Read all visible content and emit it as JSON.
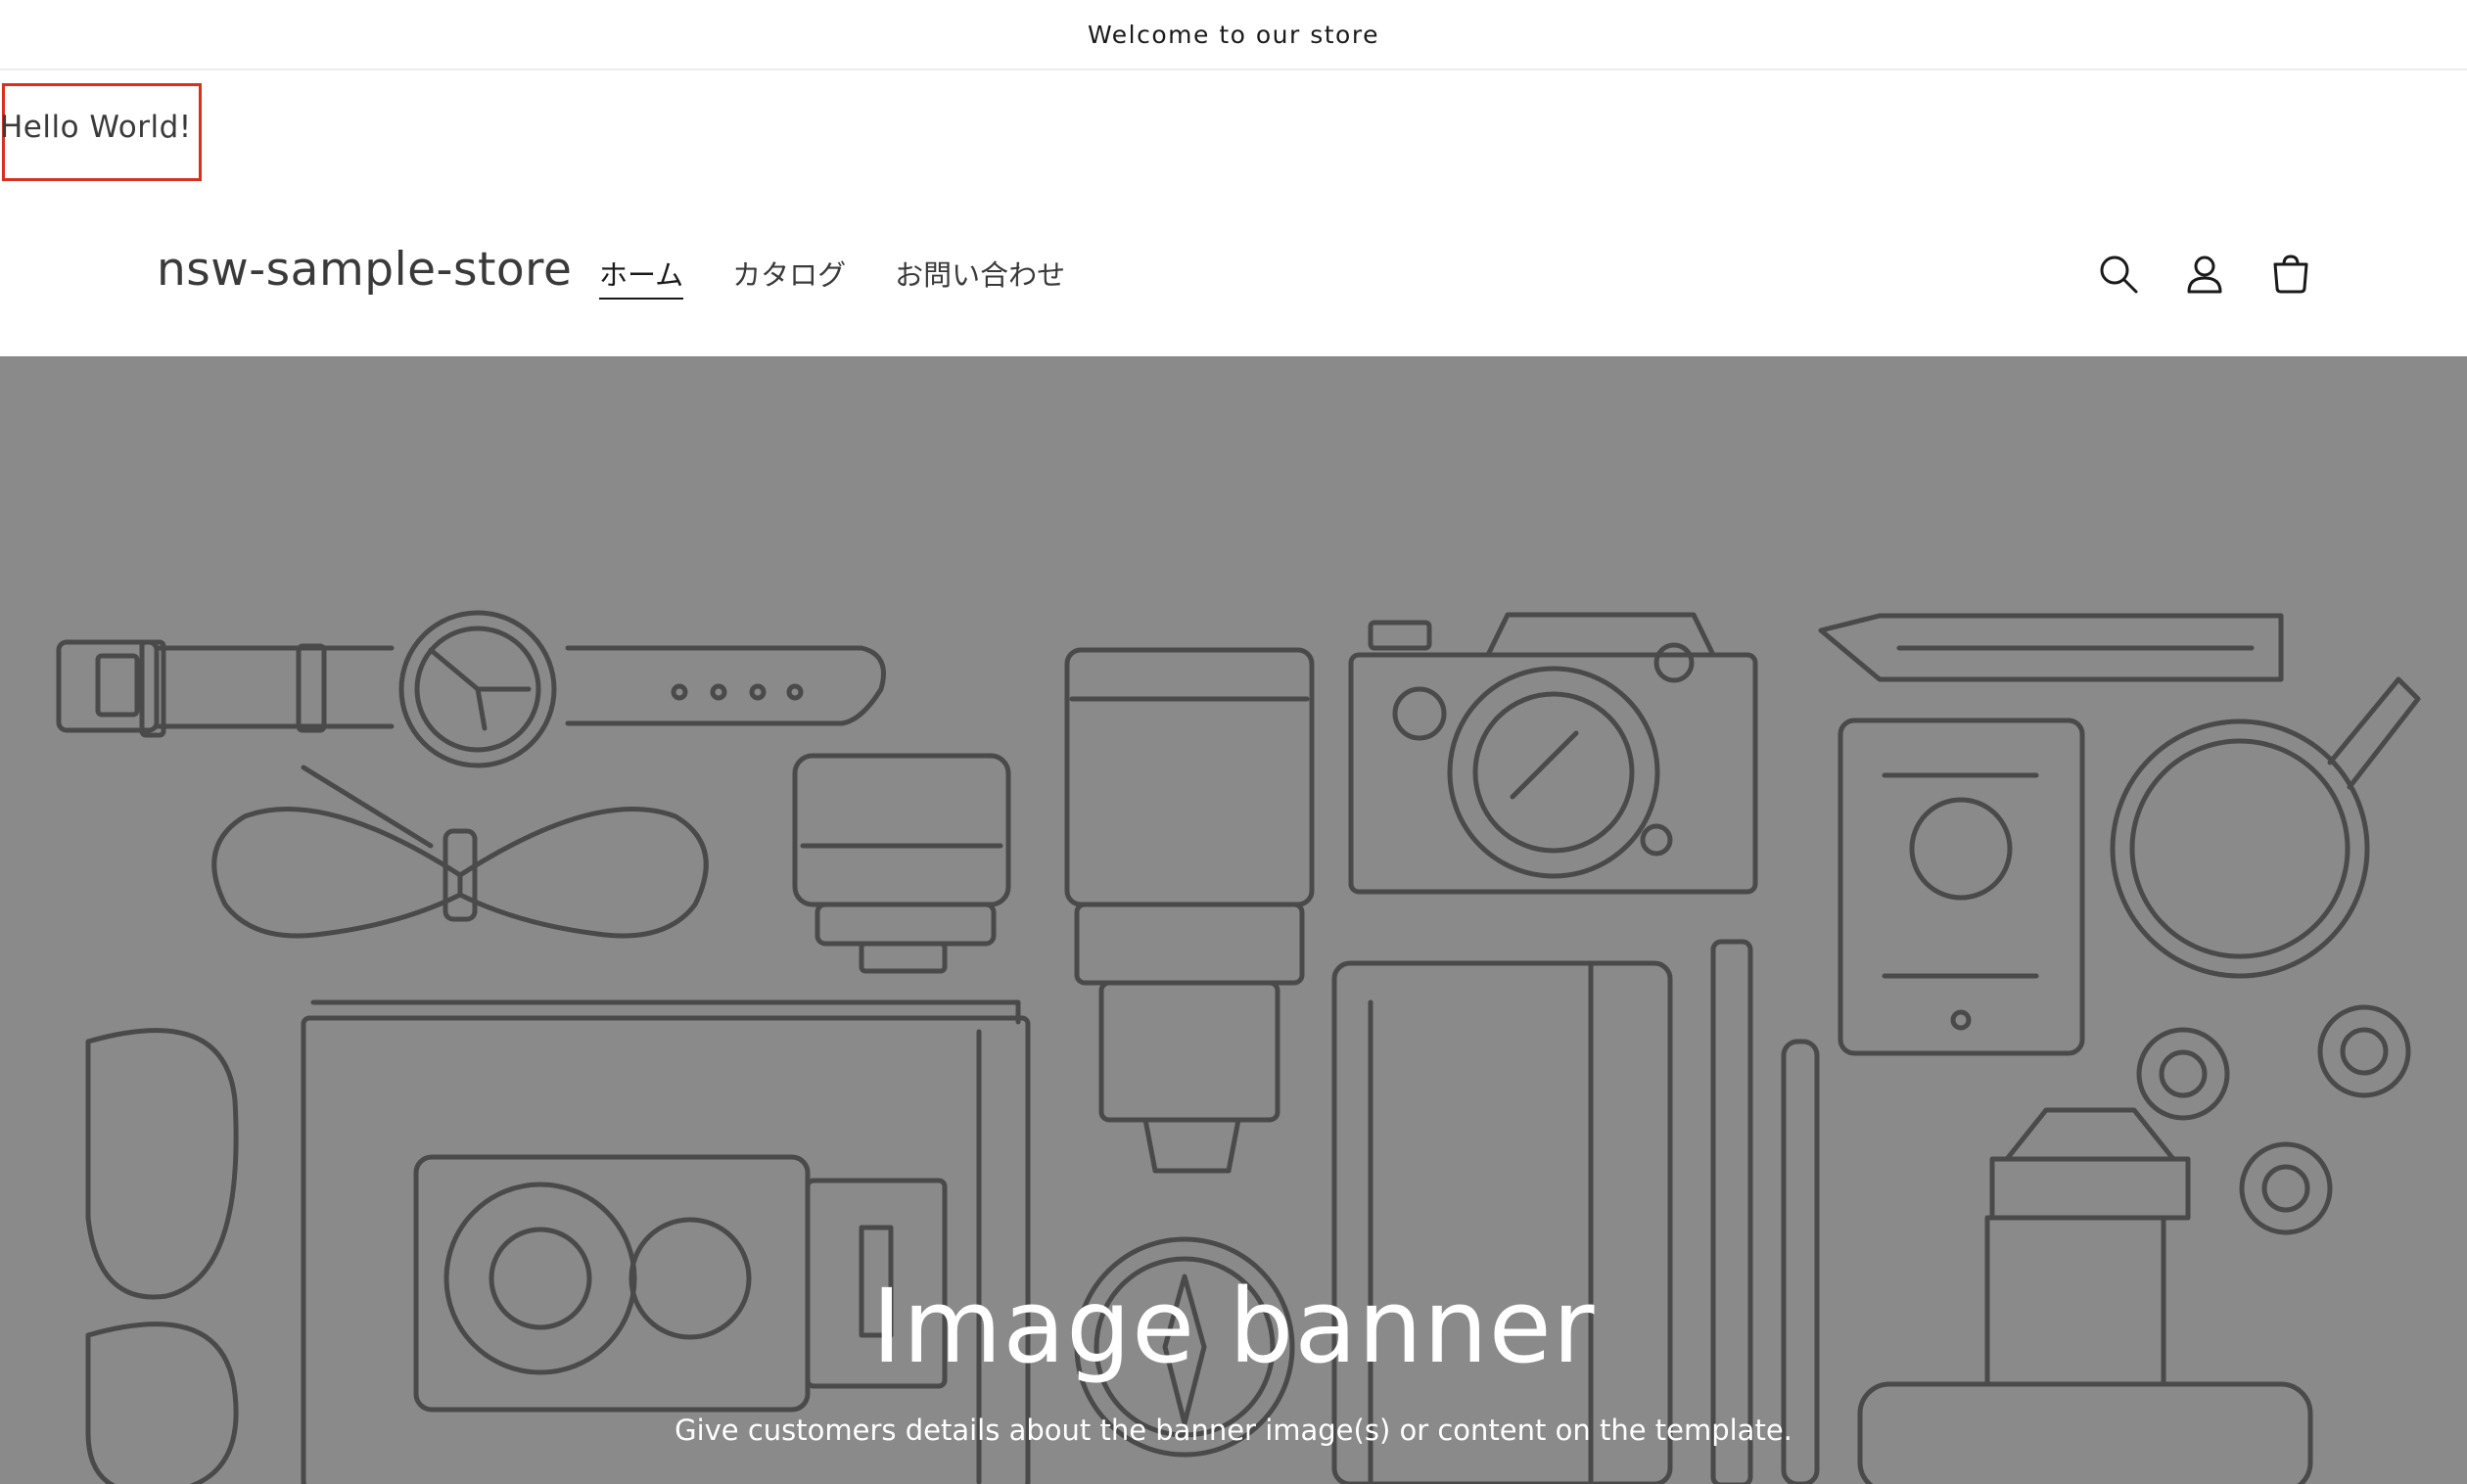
{
  "announcement": {
    "text": "Welcome to our store"
  },
  "custom_block": {
    "text": "Hello World!"
  },
  "header": {
    "store_name": "nsw-sample-store",
    "nav": [
      {
        "label": "ホーム",
        "active": true
      },
      {
        "label": "カタログ",
        "active": false
      },
      {
        "label": "お問い合わせ",
        "active": false
      }
    ],
    "icons": [
      "search-icon",
      "account-icon",
      "cart-icon"
    ]
  },
  "banner": {
    "title": "Image banner",
    "subtitle": "Give customers details about the banner image(s) or content on the template.",
    "background_color": "#8a8a8a",
    "line_color": "#4a4a4a"
  },
  "colors": {
    "highlight_box": "#d9301c",
    "text": "#3a3a3a"
  }
}
